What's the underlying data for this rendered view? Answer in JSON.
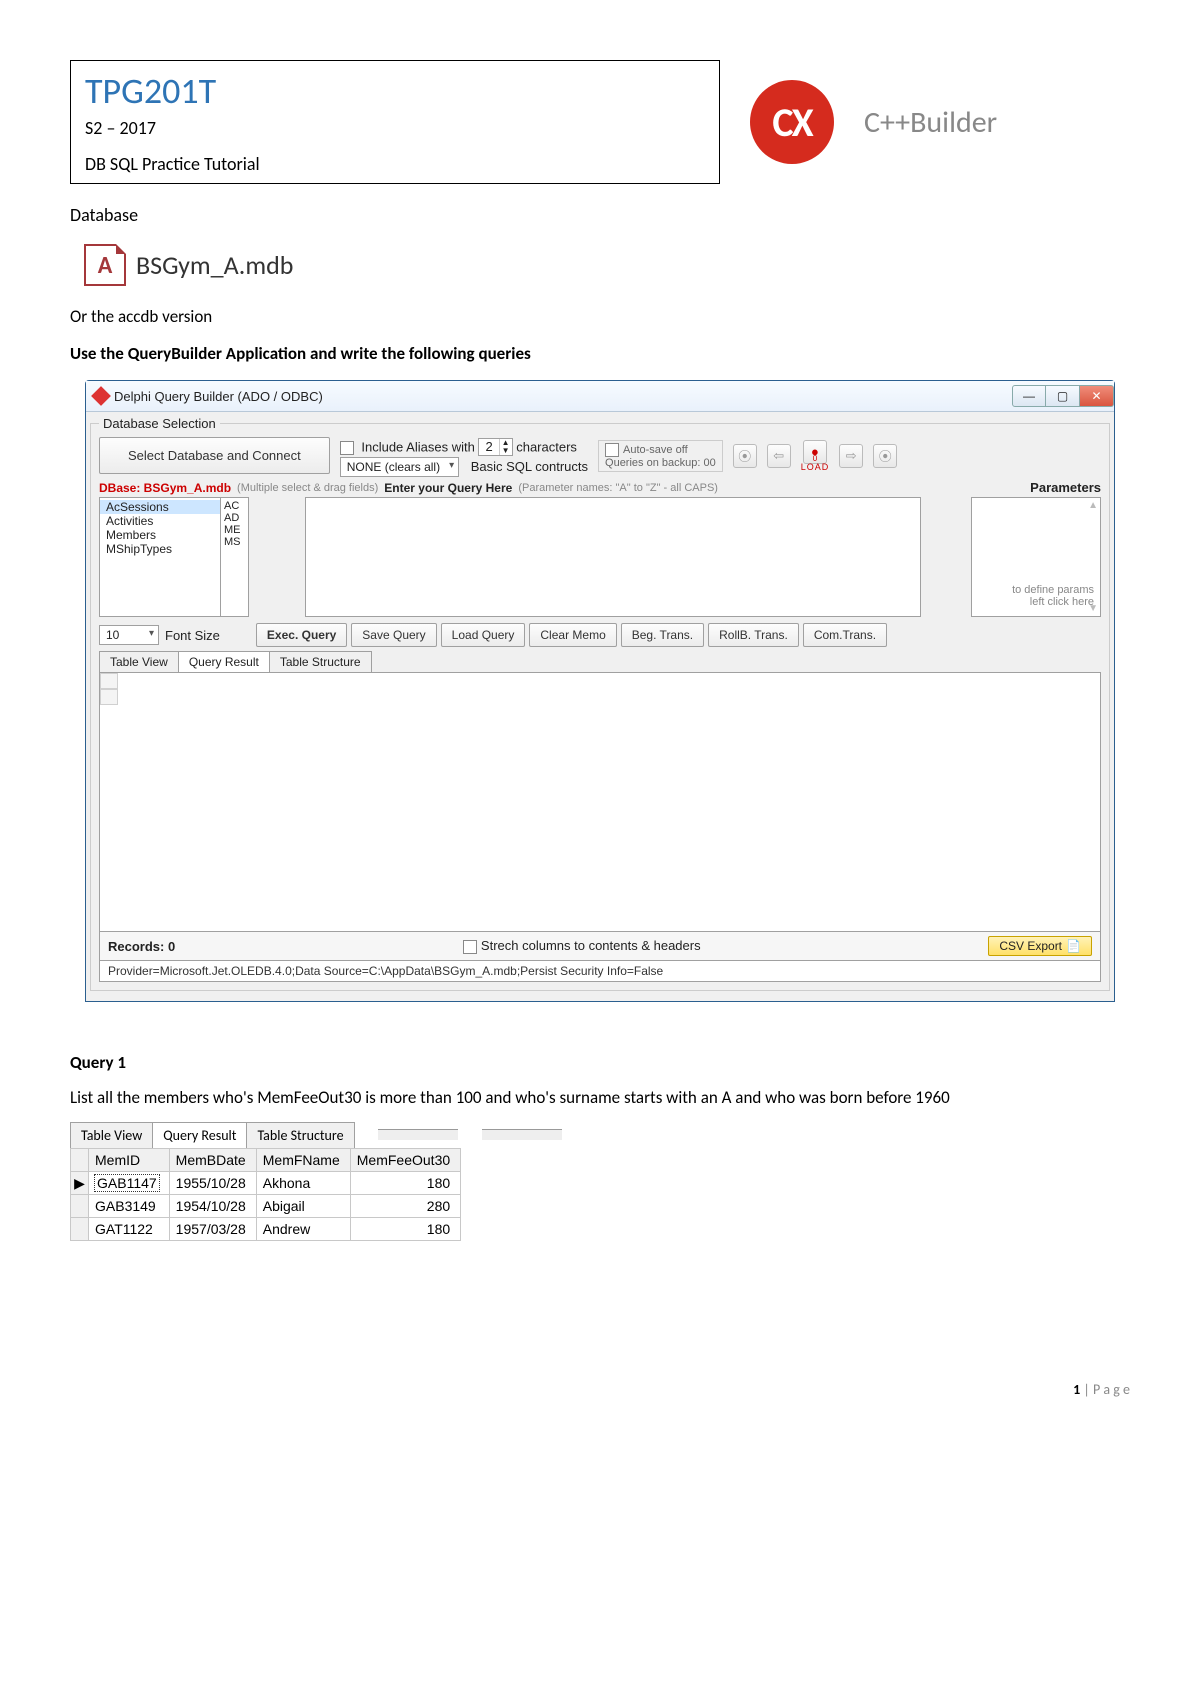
{
  "header": {
    "course_code": "TPG201T",
    "semester": "S2 – 2017",
    "tutorial": "DB SQL Practice Tutorial",
    "logo_text": "CX",
    "product": "C++Builder"
  },
  "body": {
    "database_label": "Database",
    "db_file": "BSGym_A.mdb",
    "or_line": "Or the accdb version",
    "instruction": "Use the QueryBuilder Application and write the following queries"
  },
  "qb": {
    "title": "Delphi Query Builder (ADO / ODBC)",
    "group_legend": "Database Selection",
    "select_db_btn": "Select Database and Connect",
    "include_alias_lbl": "Include Aliases  with",
    "alias_chars": "2",
    "characters_lbl": "characters",
    "none_dropdown": "NONE (clears all)",
    "basic_sql": "Basic SQL contructs",
    "autosave_lbl": "Auto-save off",
    "queries_backup": "Queries on backup: 00",
    "load_label": "LOAD",
    "db_opened": "DBase: BSGym_A.mdb",
    "multi_hint": "(Multiple select & drag fields)",
    "enter_hint": "Enter your Query Here",
    "param_hint": "(Parameter names: \"A\" to \"Z\" - all CAPS)",
    "parameters_hdr": "Parameters",
    "tables": [
      "AcSessions",
      "Activities",
      "Members",
      "MShipTypes"
    ],
    "aliases": [
      "AC",
      "AD",
      "ME",
      "MS"
    ],
    "param_define": "to define params",
    "param_click": "left click here",
    "font_size_val": "10",
    "font_size_lbl": "Font Size",
    "exec_btn": "Exec. Query",
    "save_btn": "Save Query",
    "load_btn": "Load Query",
    "clear_btn": "Clear Memo",
    "begtrans": "Beg. Trans.",
    "rollb": "RollB. Trans.",
    "commit": "Com.Trans.",
    "tabs": {
      "table_view": "Table View",
      "query_result": "Query Result",
      "table_structure": "Table Structure"
    },
    "records": "Records: 0",
    "stretch": "Strech columns to contents & headers",
    "csv": "CSV Export",
    "connstr": "Provider=Microsoft.Jet.OLEDB.4.0;Data Source=C:\\AppData\\BSGym_A.mdb;Persist Security Info=False",
    "dot_zero": "0"
  },
  "q1": {
    "heading": "Query 1",
    "description": "List all the members who's MemFeeOut30 is more than 100 and who's surname starts with an A and who was born before 1960",
    "tabs": {
      "table_view": "Table View",
      "query_result": "Query Result",
      "table_structure": "Table Structure"
    },
    "columns": [
      "MemID",
      "MemBDate",
      "MemFName",
      "MemFeeOut30"
    ],
    "rows": [
      {
        "MemID": "GAB1147",
        "MemBDate": "1955/10/28",
        "MemFName": "Akhona",
        "MemFeeOut30": "180",
        "current": true
      },
      {
        "MemID": "GAB3149",
        "MemBDate": "1954/10/28",
        "MemFName": "Abigail",
        "MemFeeOut30": "280",
        "current": false
      },
      {
        "MemID": "GAT1122",
        "MemBDate": "1957/03/28",
        "MemFName": "Andrew",
        "MemFeeOut30": "180",
        "current": false
      }
    ]
  },
  "footer": {
    "page": "1",
    "label": "P a g e"
  }
}
